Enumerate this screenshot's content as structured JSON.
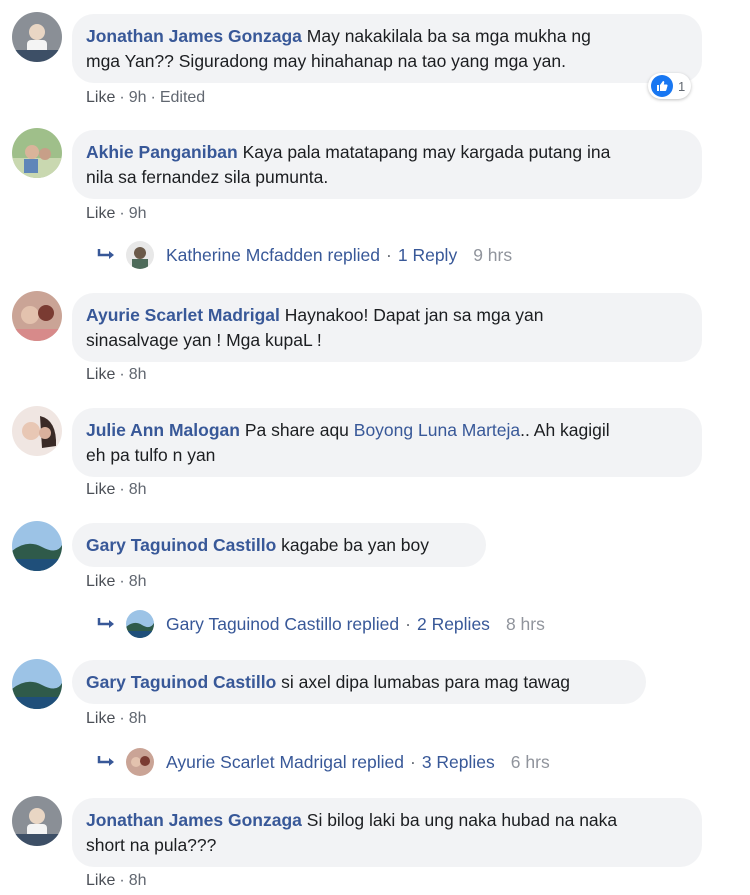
{
  "comments": [
    {
      "author": "Jonathan James Gonzaga",
      "text_lines": [
        "May nakakilala ba sa mga mukha ng",
        "mga Yan?? Siguradong may hinahanap na tao yang mga yan."
      ],
      "line1": " May nakakilala ba sa mga mukha ng",
      "line2": "mga Yan?? Siguradong may hinahanap na tao yang mga yan.",
      "like": "Like",
      "time": "9h",
      "edited": "Edited",
      "reaction_count": "1"
    },
    {
      "author": "Akhie Panganiban",
      "line1": " Kaya pala matatapang may kargada putang ina",
      "line2": "nila sa fernandez sila pumunta.",
      "like": "Like",
      "time": "9h",
      "reply": {
        "name": "Katherine Mcfadden replied",
        "count": "1 Reply",
        "time": "9 hrs"
      }
    },
    {
      "author": "Ayurie Scarlet Madrigal",
      "line1": " Haynakoo! Dapat jan sa mga yan",
      "line2": "sinasalvage yan ! Mga kupaL !",
      "like": "Like",
      "time": "8h"
    },
    {
      "author": "Julie Ann Malogan",
      "line1_a": " Pa share aqu ",
      "mention": "Boyong Luna Marteja",
      "line1_b": ".. Ah kagigil",
      "line2": "eh pa tulfo n yan",
      "like": "Like",
      "time": "8h"
    },
    {
      "author": "Gary Taguinod Castillo",
      "line1": " kagabe ba yan boy",
      "like": "Like",
      "time": "8h",
      "reply": {
        "name": "Gary Taguinod Castillo replied",
        "count": "2 Replies",
        "time": "8 hrs"
      }
    },
    {
      "author": "Gary Taguinod Castillo",
      "line1": " si axel dipa lumabas para mag tawag",
      "like": "Like",
      "time": "8h",
      "reply": {
        "name": "Ayurie Scarlet Madrigal replied",
        "count": "3 Replies",
        "time": "6 hrs"
      }
    },
    {
      "author": "Jonathan James Gonzaga",
      "line1": " Si bilog laki ba ung naka hubad na naka",
      "line2": "short na pula???",
      "like": "Like",
      "time": "8h"
    }
  ],
  "dot": "·",
  "colors": {
    "link": "#385898",
    "bubble": "#f2f3f5",
    "meta": "#616770",
    "reaction": "#1877f2"
  }
}
